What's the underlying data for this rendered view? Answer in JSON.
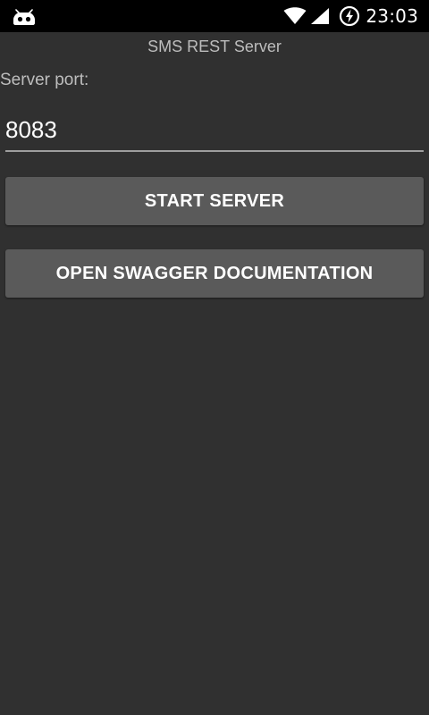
{
  "status_bar": {
    "time": "23:03",
    "left_icon": "android-icon",
    "wifi_icon": "wifi-icon",
    "signal_icon": "signal-icon",
    "battery_icon": "battery-charging-icon"
  },
  "app": {
    "title": "SMS REST Server"
  },
  "form": {
    "port_label": "Server port:",
    "port_value": "8083"
  },
  "buttons": {
    "start_label": "START SERVER",
    "swagger_label": "OPEN SWAGGER DOCUMENTATION"
  },
  "colors": {
    "background": "#303030",
    "status_bar": "#000000",
    "button": "#5a5a5a",
    "text_secondary": "#bdbdbd",
    "text_primary": "#ffffff"
  }
}
